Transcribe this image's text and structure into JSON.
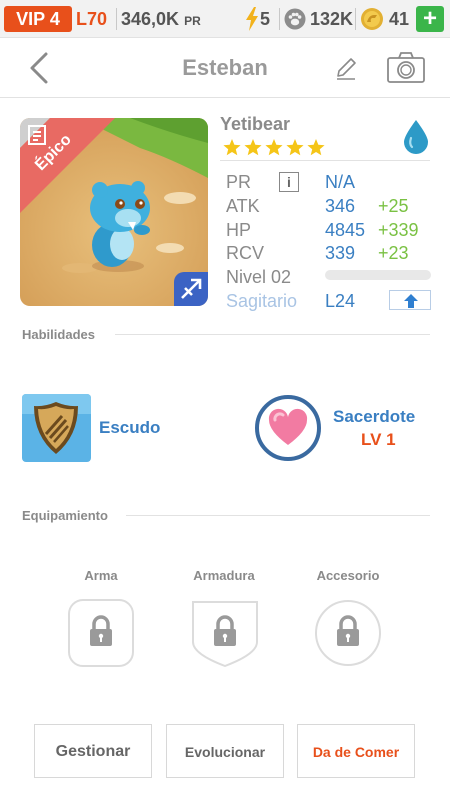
{
  "status_bar": {
    "vip": "VIP 4",
    "level": "L70",
    "pr_value": "346,0K",
    "pr_unit": "PR",
    "energy": "5",
    "paw": "132K",
    "coins": "41"
  },
  "header": {
    "title": "Esteban"
  },
  "creature": {
    "rarity": "Épico",
    "name": "Yetibear",
    "stars": 5,
    "stats": {
      "pr_label": "PR",
      "pr_value": "N/A",
      "atk_label": "ATK",
      "atk_value": "346",
      "atk_bonus": "+25",
      "hp_label": "HP",
      "hp_value": "4845",
      "hp_bonus": "+339",
      "rcv_label": "RCV",
      "rcv_value": "339",
      "rcv_bonus": "+23",
      "level_label": "Nivel 02",
      "level_progress": 0,
      "sign": "Sagitario",
      "sign_level": "L24"
    }
  },
  "abilities": {
    "title": "Habilidades",
    "items": [
      {
        "name": "Escudo",
        "icon": "shield-icon"
      },
      {
        "name": "Sacerdote",
        "level": "LV 1",
        "icon": "heart-icon"
      }
    ]
  },
  "equipment": {
    "title": "Equipamiento",
    "slots": [
      {
        "label": "Arma",
        "locked": true
      },
      {
        "label": "Armadura",
        "locked": true
      },
      {
        "label": "Accesorio",
        "locked": true
      }
    ]
  },
  "actions": {
    "manage": "Gestionar",
    "evolve": "Evolucionar",
    "feed": "Da de Comer"
  },
  "colors": {
    "accent_orange": "#e8501b",
    "value_blue": "#3a7fc2",
    "bonus_green": "#7ac143",
    "star_gold": "#f5c518"
  }
}
